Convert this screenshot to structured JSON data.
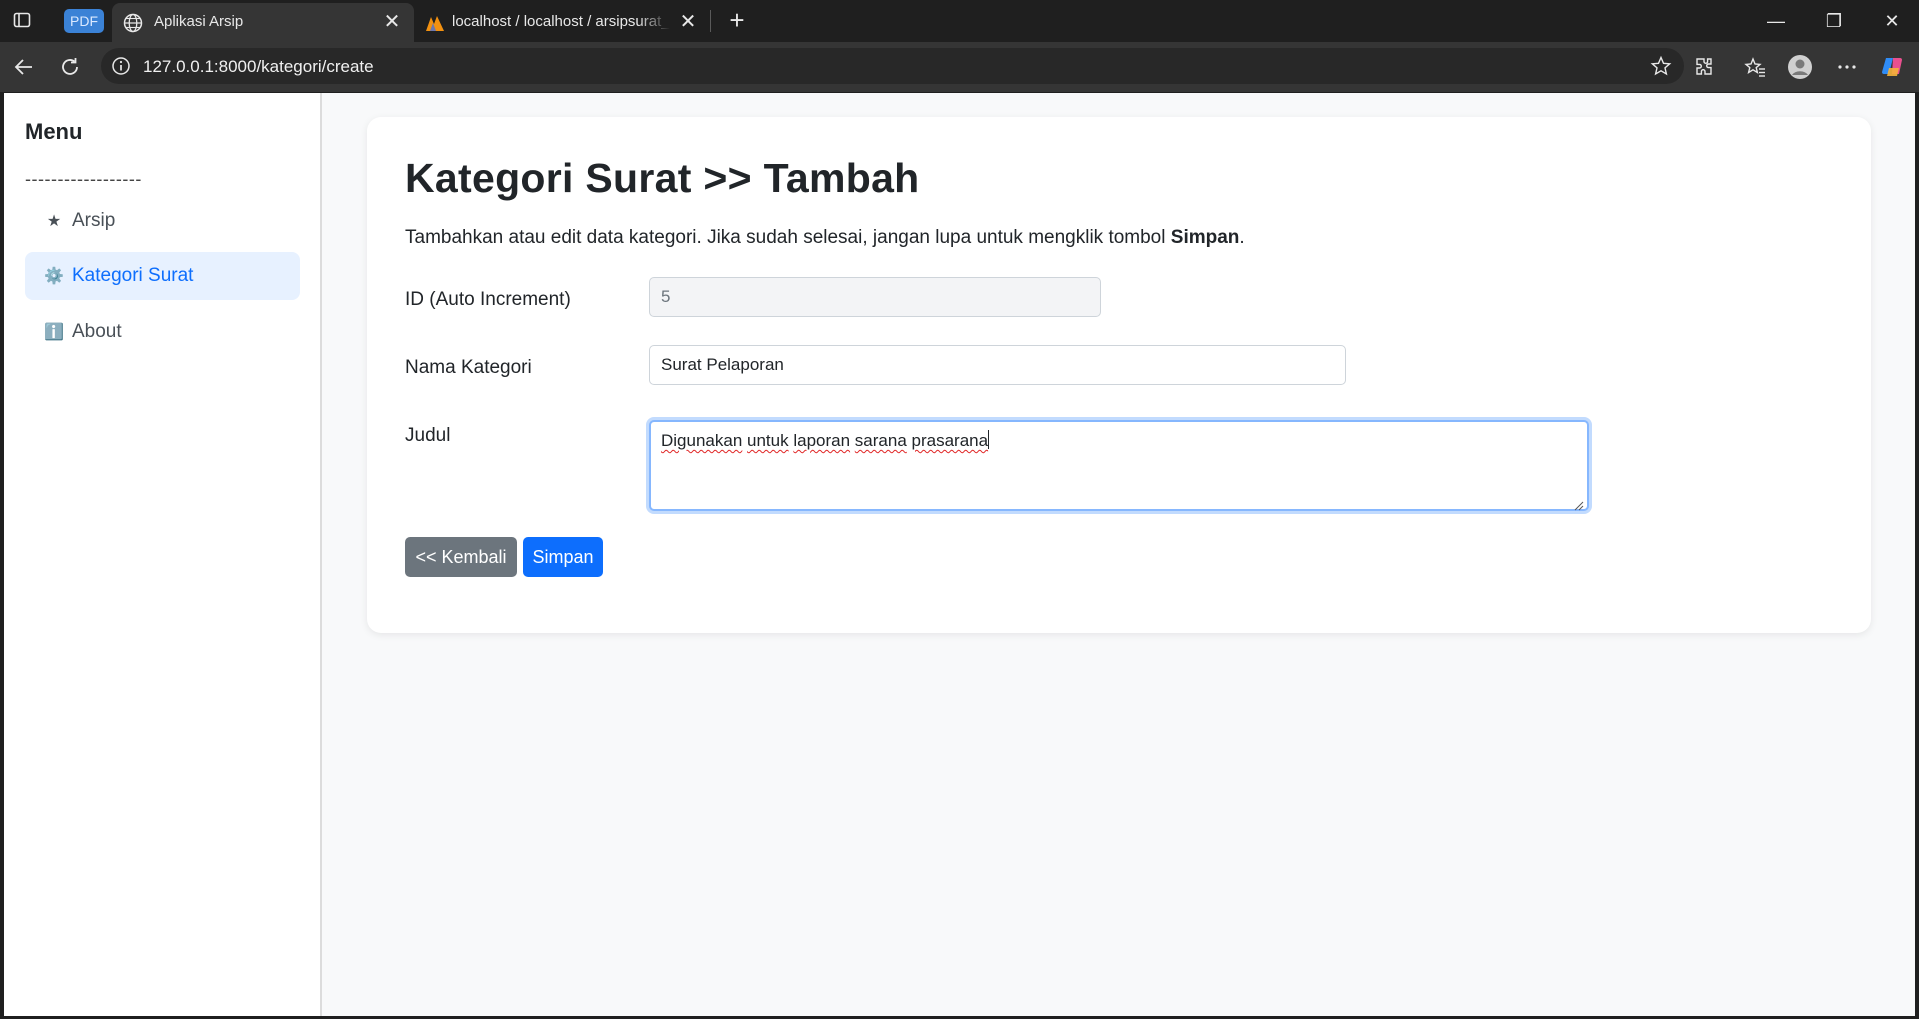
{
  "browser": {
    "pdf_badge": "PDF",
    "tabs": [
      {
        "title": "Aplikasi Arsip",
        "icon": "globe-icon",
        "active": true
      },
      {
        "title": "localhost / localhost / arsipsurat_l",
        "icon": "phpmyadmin-icon",
        "active": false
      }
    ],
    "close_glyph": "✕",
    "new_tab_glyph": "+",
    "url": "127.0.0.1:8000/kategori/create",
    "window_controls": {
      "minimize": "—",
      "restore": "❐",
      "close": "✕"
    }
  },
  "sidebar": {
    "title": "Menu",
    "divider": "------------------",
    "items": [
      {
        "icon": "★",
        "label": "Arsip",
        "active": false
      },
      {
        "icon": "⚙️",
        "label": "Kategori Surat",
        "active": true
      },
      {
        "icon": "ℹ️",
        "label": "About",
        "active": false
      }
    ]
  },
  "page": {
    "title": "Kategori Surat >> Tambah",
    "description_prefix": "Tambahkan atau edit data kategori. Jika sudah selesai, jangan lupa untuk mengklik tombol ",
    "description_bold": "Simpan",
    "description_suffix": "."
  },
  "form": {
    "id_label": "ID (Auto Increment)",
    "id_value": "5",
    "nama_label": "Nama Kategori",
    "nama_value": "Surat Pelaporan",
    "judul_label": "Judul",
    "judul_words": [
      "Digunakan",
      "untuk",
      "laporan",
      "sarana",
      "prasarana"
    ],
    "back_button": "<< Kembali",
    "save_button": "Simpan"
  },
  "colors": {
    "accent": "#0d6efd",
    "secondary": "#6c757d",
    "active_nav_bg": "#e7f1ff"
  }
}
